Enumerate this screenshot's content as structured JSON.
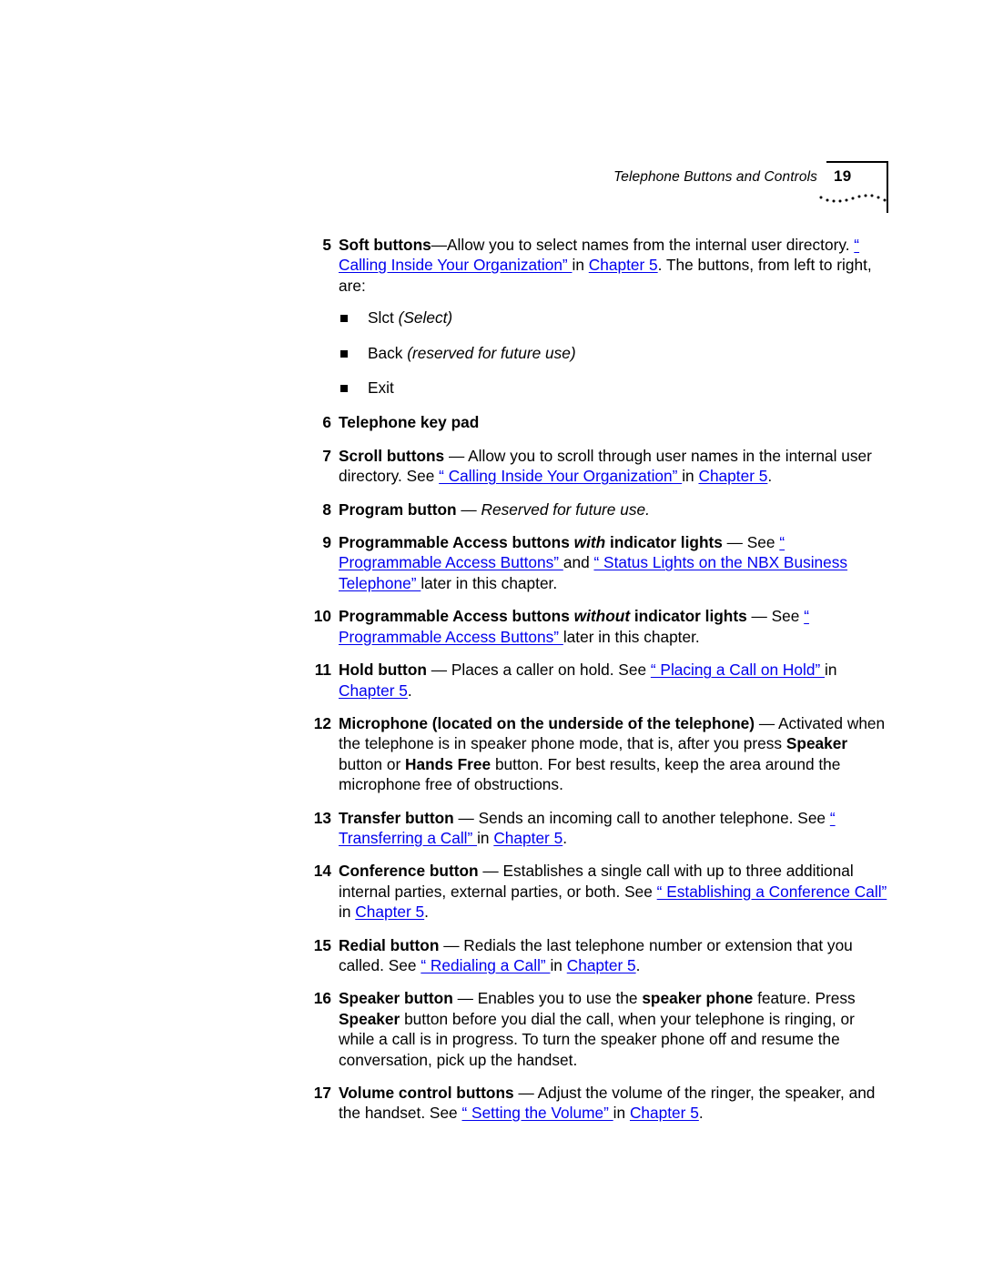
{
  "page": {
    "header_title": "Telephone Buttons and Controls",
    "page_number": "19",
    "link_color": "#0000ee",
    "text_color": "#000000",
    "background": "#ffffff"
  },
  "items": {
    "i5": {
      "num": "5",
      "lead": "Soft buttons",
      "dash": "—",
      "t1": "Allow you to select names from the internal user directory. ",
      "l1": "“ Calling Inside Your Organization” ",
      "t2": " in ",
      "l2": "Chapter 5",
      "t3": ". The buttons, from left to right, are:",
      "bullets": [
        {
          "text": "Slct ",
          "italic": "(Select)"
        },
        {
          "text": "Back ",
          "italic": "(reserved for future use)"
        },
        {
          "text": "Exit",
          "italic": ""
        }
      ]
    },
    "i6": {
      "num": "6",
      "lead": "Telephone key pad"
    },
    "i7": {
      "num": "7",
      "lead": "Scroll buttons",
      "dash": " — ",
      "t1": "Allow you to scroll through user names in the internal user directory. See ",
      "l1": "“ Calling Inside Your Organization” ",
      "t2": " in ",
      "l2": "Chapter 5",
      "t3": "."
    },
    "i8": {
      "num": "8",
      "lead": "Program button",
      "dash": " — ",
      "italic": "Reserved for future use."
    },
    "i9": {
      "num": "9",
      "lead1": "Programmable Access buttons ",
      "leadem": "with",
      "lead2": " indicator lights",
      "dash": " — ",
      "t1": "See ",
      "l1": "“ Programmable Access Buttons” ",
      "t2": " and ",
      "l2": "“ Status Lights on the NBX Business Telephone” ",
      "t3": " later in this chapter."
    },
    "i10": {
      "num": "10",
      "lead1": "Programmable Access buttons ",
      "leadem": "without",
      "lead2": " indicator lights",
      "dash": " — ",
      "t1": "See ",
      "l1": "“ Programmable Access Buttons” ",
      "t2": " later in this chapter."
    },
    "i11": {
      "num": "11",
      "lead": "Hold button",
      "dash": " — ",
      "t1": "Places a caller on hold. See ",
      "l1": "“ Placing a Call on Hold” ",
      "t2": " in ",
      "l2": "Chapter 5",
      "t3": "."
    },
    "i12": {
      "num": "12",
      "lead": "Microphone (located on the underside of the telephone)",
      "dash": " — ",
      "t1": "Activated when the telephone is in speaker phone mode, that is, after you press ",
      "b1": "Speaker",
      "t2": " button or ",
      "b2": "Hands Free",
      "t3": " button. For best results, keep the area around the microphone free of obstructions."
    },
    "i13": {
      "num": "13",
      "lead": "Transfer button",
      "dash": " — ",
      "t1": "Sends an incoming call to another telephone. See ",
      "l1": "“ Transferring a Call” ",
      "t2": " in ",
      "l2": "Chapter 5",
      "t3": "."
    },
    "i14": {
      "num": "14",
      "lead": "Conference button",
      "dash": " — ",
      "t1": "Establishes a single call with up to three additional internal parties, external parties, or both. See ",
      "l1": "“ Establishing a Conference Call” ",
      "t2": " in ",
      "l2": "Chapter 5",
      "t3": "."
    },
    "i15": {
      "num": "15",
      "lead": "Redial button",
      "dash": " — ",
      "t1": "Redials the last telephone number or extension that you called. See ",
      "l1": "“ Redialing a Call” ",
      "t2": " in ",
      "l2": "Chapter 5",
      "t3": "."
    },
    "i16": {
      "num": "16",
      "lead": "Speaker button",
      "dash": " — ",
      "t1": "Enables you to use the ",
      "b1": "speaker phone",
      "t2": " feature. Press ",
      "b2": "Speaker",
      "t3": " button before you dial the call, when your telephone is ringing, or while a call is in progress. To turn the speaker phone off and resume the conversation, pick up the handset."
    },
    "i17": {
      "num": "17",
      "lead": "Volume control buttons",
      "dash": " — ",
      "t1": "Adjust the volume of the ringer, the speaker, and the handset. See ",
      "l1": "“ Setting the Volume” ",
      "t2": " in ",
      "l2": "Chapter 5",
      "t3": "."
    }
  }
}
